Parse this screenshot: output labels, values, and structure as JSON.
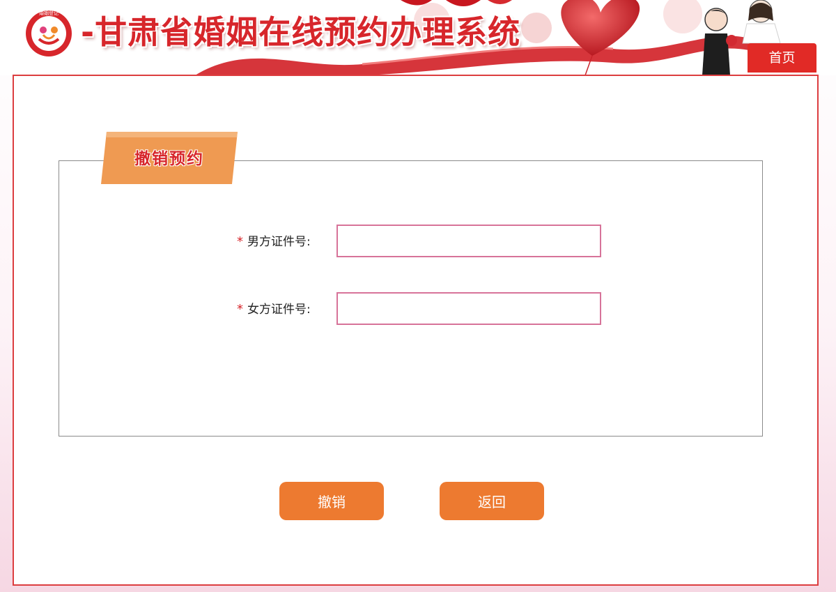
{
  "header": {
    "site_title": "-甘肃省婚姻在线预约办理系统",
    "logo_text": "婚姻登记",
    "home_label": "首页"
  },
  "panel": {
    "tab_label": "撤销预约"
  },
  "form": {
    "required_mark": "*",
    "male_id_label": "男方证件号:",
    "male_id_value": "",
    "female_id_label": "女方证件号:",
    "female_id_value": ""
  },
  "actions": {
    "cancel_label": "撤销",
    "back_label": "返回"
  },
  "colors": {
    "brand_red": "#d7262b",
    "button_orange": "#ed7a30",
    "input_border": "#d77399",
    "tab_orange": "#ef9a52"
  }
}
